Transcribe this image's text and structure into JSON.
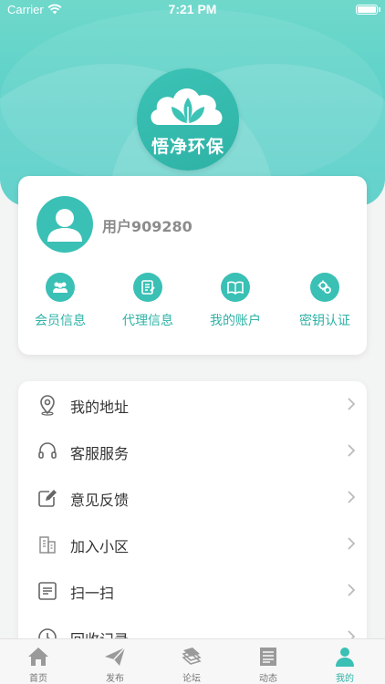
{
  "status_bar": {
    "carrier": "Carrier",
    "time": "7:21 PM"
  },
  "header": {
    "logo_text": "悟净环保"
  },
  "profile": {
    "username": "用户909280",
    "quick_actions": [
      {
        "label": "会员信息",
        "icon": "members-icon"
      },
      {
        "label": "代理信息",
        "icon": "agent-icon"
      },
      {
        "label": "我的账户",
        "icon": "account-book-icon"
      },
      {
        "label": "密钥认证",
        "icon": "key-gear-icon"
      }
    ]
  },
  "menu": {
    "items": [
      {
        "label": "我的地址",
        "icon": "location-pin-icon"
      },
      {
        "label": "客服服务",
        "icon": "headset-icon"
      },
      {
        "label": "意见反馈",
        "icon": "edit-icon"
      },
      {
        "label": "加入小区",
        "icon": "building-icon"
      },
      {
        "label": "扫一扫",
        "icon": "scan-icon"
      },
      {
        "label": "回收记录",
        "icon": "clock-icon"
      }
    ]
  },
  "tab_bar": {
    "tabs": [
      {
        "label": "首页",
        "icon": "home-icon"
      },
      {
        "label": "发布",
        "icon": "send-icon"
      },
      {
        "label": "论坛",
        "icon": "forum-icon"
      },
      {
        "label": "动态",
        "icon": "news-icon"
      },
      {
        "label": "我的",
        "icon": "profile-icon"
      }
    ],
    "active_index": 4
  },
  "colors": {
    "accent": "#3ac0b5",
    "header": "#59d0c8"
  }
}
